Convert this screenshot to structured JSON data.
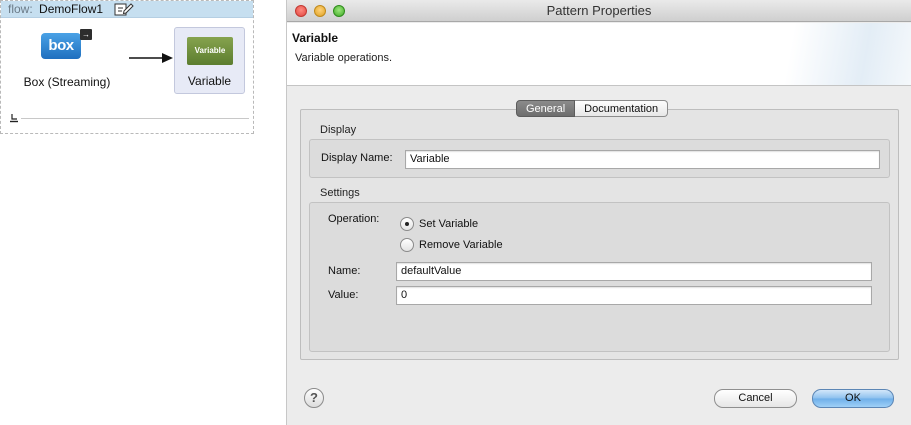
{
  "flow": {
    "label": "flow:",
    "name": "DemoFlow1",
    "nodes": [
      {
        "icon": "box-logo-icon",
        "logo_text": "box",
        "label": "Box (Streaming)"
      },
      {
        "icon": "variable-transformer-icon",
        "icon_text": "Variable",
        "label": "Variable"
      }
    ]
  },
  "dialog": {
    "title": "Pattern Properties",
    "banner": {
      "title": "Variable",
      "description": "Variable operations."
    },
    "tabs": [
      {
        "label": "General",
        "active": true
      },
      {
        "label": "Documentation",
        "active": false
      }
    ],
    "display_group": {
      "title": "Display",
      "display_name_label": "Display Name:",
      "display_name_value": "Variable"
    },
    "settings_group": {
      "title": "Settings",
      "operation_label": "Operation:",
      "options": [
        {
          "label": "Set Variable",
          "checked": true
        },
        {
          "label": "Remove Variable",
          "checked": false
        }
      ],
      "name_label": "Name:",
      "name_value": "defaultValue",
      "value_label": "Value:",
      "value_value": "0"
    },
    "help_symbol": "?",
    "cancel_label": "Cancel",
    "ok_label": "OK"
  },
  "colors": {
    "flow_header": "#c6dff0",
    "variable_node_bg": "#e7eaf6",
    "variable_icon": "#6f8f3c",
    "box_logo": "#2f82d2",
    "ok_button": "#8cc0ee"
  }
}
